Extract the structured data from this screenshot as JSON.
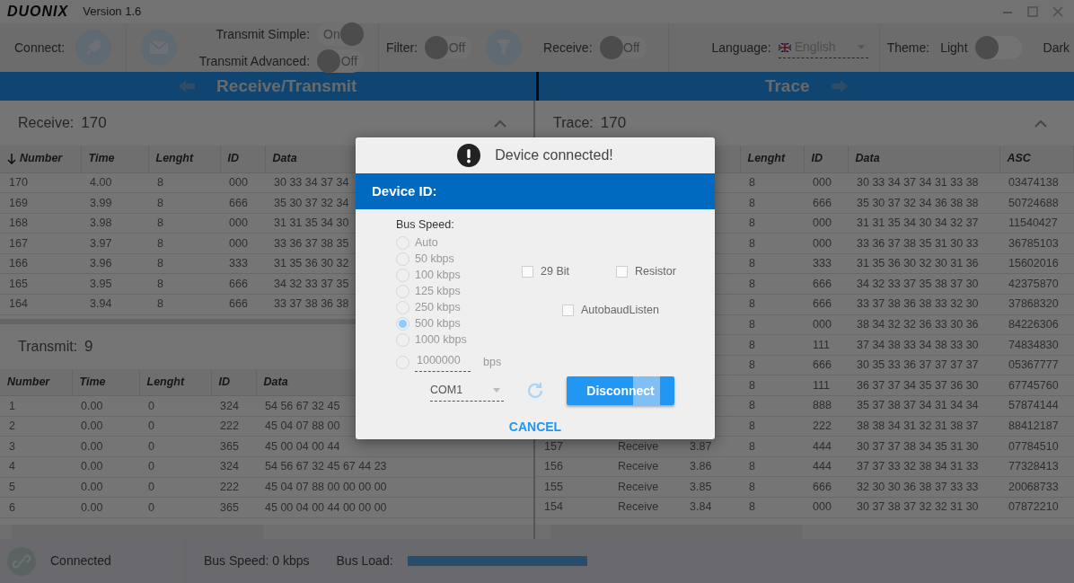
{
  "window": {
    "logo": "DUONIX",
    "version": "Version 1.6"
  },
  "toolbar": {
    "connect_label": "Connect:",
    "transmit_simple": {
      "label": "Transmit Simple:",
      "on": true,
      "text": "On"
    },
    "transmit_advanced": {
      "label": "Transmit Advanced:",
      "on": false,
      "text": "Off"
    },
    "filter": {
      "label": "Filter:",
      "on": false,
      "text": "Off"
    },
    "receive": {
      "label": "Receive:",
      "on": false,
      "text": "Off"
    },
    "language": {
      "label": "Language:",
      "value": "English"
    },
    "theme": {
      "label": "Theme:",
      "left": "Light",
      "right": "Dark",
      "on": false
    }
  },
  "panel_headers": [
    {
      "title": "Receive/Transmit",
      "kind": "back"
    },
    {
      "title": "Trace",
      "kind": "forward"
    }
  ],
  "receive": {
    "label": "Receive:",
    "count": "170",
    "columns": [
      {
        "label": "Number",
        "sorted": true
      },
      {
        "label": "Time",
        "sorted": false
      },
      {
        "label": "Lenght",
        "sorted": false
      },
      {
        "label": "ID",
        "sorted": false
      },
      {
        "label": "Data",
        "sorted": false
      }
    ],
    "rows": [
      [
        "170",
        "4.00",
        "8",
        "000",
        "30 33 34 37 34"
      ],
      [
        "169",
        "3.99",
        "8",
        "666",
        "35 30 37 32 34"
      ],
      [
        "168",
        "3.98",
        "8",
        "000",
        "31 31 35 34 30"
      ],
      [
        "167",
        "3.97",
        "8",
        "000",
        "33 36 37 38 35"
      ],
      [
        "166",
        "3.96",
        "8",
        "333",
        "31 35 36 30 32"
      ],
      [
        "165",
        "3.95",
        "8",
        "666",
        "34 32 33 37 35"
      ],
      [
        "164",
        "3.94",
        "8",
        "666",
        "33 37 38 36 38"
      ]
    ]
  },
  "transmit": {
    "label": "Transmit:",
    "count": "9",
    "columns": [
      {
        "label": "Number",
        "sorted": false
      },
      {
        "label": "Time",
        "sorted": false
      },
      {
        "label": "Lenght",
        "sorted": false
      },
      {
        "label": "ID",
        "sorted": false
      },
      {
        "label": "Data",
        "sorted": false
      }
    ],
    "rows": [
      [
        "1",
        "0.00",
        "0",
        "324",
        "54 56 67 32 45"
      ],
      [
        "2",
        "0.00",
        "0",
        "222",
        "45 04 07 88 00"
      ],
      [
        "3",
        "0.00",
        "0",
        "365",
        "45 00 04 00 44"
      ],
      [
        "4",
        "0.00",
        "0",
        "324",
        "54 56 67 32 45 67 44 23"
      ],
      [
        "5",
        "0.00",
        "0",
        "222",
        "45 04 07 88 00 00 00 00"
      ],
      [
        "6",
        "0.00",
        "0",
        "365",
        "45 00 04 00 44 00 00 00"
      ]
    ]
  },
  "trace": {
    "label": "Trace:",
    "count": "170",
    "columns": [
      "Lenght",
      "ID",
      "Data",
      "ASC"
    ],
    "rows": [
      {
        "length": "8",
        "id": "000",
        "data": "30 33 34 37 34 31 33 38",
        "asc": "03474138"
      },
      {
        "length": "8",
        "id": "666",
        "data": "35 30 37 32 34 36 38 38",
        "asc": "50724688"
      },
      {
        "length": "8",
        "id": "000",
        "data": "31 31 35 34 30 34 32 37",
        "asc": "11540427"
      },
      {
        "length": "8",
        "id": "000",
        "data": "33 36 37 38 35 31 30 33",
        "asc": "36785103"
      },
      {
        "length": "8",
        "id": "333",
        "data": "31 35 36 30 32 30 31 36",
        "asc": "15602016"
      },
      {
        "length": "8",
        "id": "666",
        "data": "34 32 33 37 35 38 37 30",
        "asc": "42375870"
      },
      {
        "length": "8",
        "id": "666",
        "data": "33 37 38 36 38 33 32 30",
        "asc": "37868320"
      },
      {
        "length": "8",
        "id": "000",
        "data": "38 34 32 32 36 33 30 36",
        "asc": "84226306"
      },
      {
        "length": "8",
        "id": "111",
        "data": "37 34 38 33 34 38 33 30",
        "asc": "74834830"
      },
      {
        "length": "8",
        "id": "666",
        "data": "30 35 33 36 37 37 37 37",
        "asc": "05367777"
      },
      {
        "length": "8",
        "id": "111",
        "data": "36 37 37 34 35 37 36 30",
        "asc": "67745760"
      },
      {
        "length": "8",
        "id": "888",
        "data": "35 37 38 37 34 31 34 34",
        "asc": "57874144"
      },
      {
        "length": "8",
        "id": "222",
        "data": "38 38 34 31 32 31 38 37",
        "asc": "88412187"
      },
      {
        "number": "157",
        "type": "Receive",
        "time": "3.87",
        "length": "8",
        "id": "444",
        "data": "30 37 37 38 34 35 31 30",
        "asc": "07784510"
      },
      {
        "number": "156",
        "type": "Receive",
        "time": "3.86",
        "length": "8",
        "id": "444",
        "data": "37 37 33 32 38 34 31 33",
        "asc": "77328413"
      },
      {
        "number": "155",
        "type": "Receive",
        "time": "3.85",
        "length": "8",
        "id": "666",
        "data": "32 30 30 36 38 37 33 33",
        "asc": "20068733"
      },
      {
        "number": "154",
        "type": "Receive",
        "time": "3.84",
        "length": "8",
        "id": "000",
        "data": "30 37 38 37 32 32 31 30",
        "asc": "07872210"
      }
    ]
  },
  "status_bar": {
    "connection": "Connected",
    "bus_speed": "Bus Speed: 0 kbps",
    "bus_load": {
      "label": "Bus Load:",
      "level": 1
    }
  },
  "dialog": {
    "message": "Device connected!",
    "title": "Device ID:",
    "bus_speed_label": "Bus Speed:",
    "disabled": true,
    "bus_speeds": [
      {
        "label": "Auto",
        "selected": false
      },
      {
        "label": "50 kbps",
        "selected": false
      },
      {
        "label": "100 kbps",
        "selected": false
      },
      {
        "label": "125 kbps",
        "selected": false
      },
      {
        "label": "250 kbps",
        "selected": false
      },
      {
        "label": "500 kbps",
        "selected": true
      },
      {
        "label": "1000 kbps",
        "selected": false
      }
    ],
    "custom_speed": {
      "value": "1000000",
      "unit": "bps",
      "selected": false
    },
    "options": [
      {
        "label": "29 Bit",
        "checked": false
      },
      {
        "label": "Resistor",
        "checked": false
      },
      {
        "label": "AutobaudListen",
        "checked": false
      }
    ],
    "port": "COM1",
    "primary_button": "Disconnect",
    "cancel": "CANCEL"
  }
}
